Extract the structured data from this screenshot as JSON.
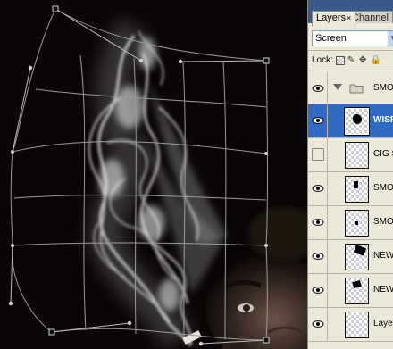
{
  "canvas": {
    "description_icon": "warp-transform-mesh"
  },
  "layers_panel": {
    "tabs": [
      {
        "label": "Layers",
        "active": true
      },
      {
        "label": "Channel",
        "active": false
      }
    ],
    "blend_mode": "Screen",
    "lock_label": "Lock:",
    "layers": [
      {
        "name": "SMOK",
        "type": "group",
        "visible": true,
        "expanded": true
      },
      {
        "name": "WISP",
        "type": "layer",
        "visible": true,
        "selected": true
      },
      {
        "name": "CIG S",
        "type": "layer",
        "visible": false
      },
      {
        "name": "SMOK",
        "type": "layer",
        "visible": true
      },
      {
        "name": "SMOK",
        "type": "layer",
        "visible": true
      },
      {
        "name": "NEW_",
        "type": "layer",
        "visible": true
      },
      {
        "name": "NEW_",
        "type": "layer",
        "visible": true
      },
      {
        "name": "Layer",
        "type": "layer",
        "visible": true
      }
    ]
  },
  "colors": {
    "selection": "#316ac5",
    "panel_bg": "#ece9d8",
    "tab_strip": "#3a5a8a"
  }
}
